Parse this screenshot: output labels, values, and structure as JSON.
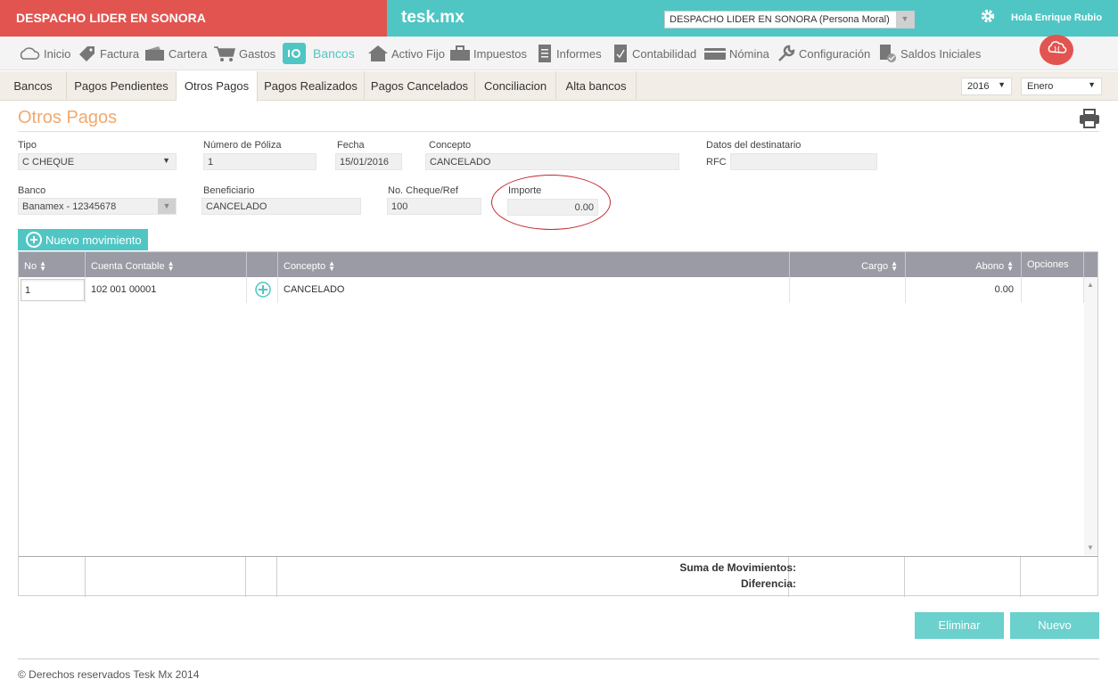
{
  "header": {
    "company": "DESPACHO LIDER EN SONORA",
    "brand": "tesk.mx",
    "company_selector": "DESPACHO LIDER EN SONORA (Persona Moral)",
    "greeting": "Hola Enrique Rubio"
  },
  "nav": {
    "items": [
      {
        "label": "Inicio",
        "icon": "cloud-icon"
      },
      {
        "label": "Factura",
        "icon": "tag-icon"
      },
      {
        "label": "Cartera",
        "icon": "wallet-icon"
      },
      {
        "label": "Gastos",
        "icon": "cart-icon"
      },
      {
        "label": "Bancos",
        "icon": "safe-icon"
      },
      {
        "label": "Activo Fijo",
        "icon": "house-icon"
      },
      {
        "label": "Impuestos",
        "icon": "briefcase-icon"
      },
      {
        "label": "Informes",
        "icon": "document-icon"
      },
      {
        "label": "Contabilidad",
        "icon": "ledger-icon"
      },
      {
        "label": "Nómina",
        "icon": "card-icon"
      },
      {
        "label": "Configuración",
        "icon": "wrench-icon"
      },
      {
        "label": "Saldos Iniciales",
        "icon": "file-check-icon"
      }
    ],
    "active": "Bancos"
  },
  "tabs": {
    "items": [
      "Bancos",
      "Pagos Pendientes",
      "Otros Pagos",
      "Pagos Realizados",
      "Pagos Cancelados",
      "Conciliacion",
      "Alta bancos"
    ],
    "active": "Otros Pagos",
    "year": "2016",
    "month": "Enero"
  },
  "page": {
    "title": "Otros Pagos"
  },
  "form": {
    "tipo_label": "Tipo",
    "tipo_value": "C CHEQUE",
    "poliza_label": "Número de Póliza",
    "poliza_value": "1",
    "fecha_label": "Fecha",
    "fecha_value": "15/01/2016",
    "concepto_label": "Concepto",
    "concepto_value": "CANCELADO",
    "destinatario_label": "Datos del destinatario",
    "rfc_label": "RFC",
    "rfc_value": "",
    "banco_label": "Banco",
    "banco_value": "Banamex - 12345678",
    "beneficiario_label": "Beneficiario",
    "beneficiario_value": "CANCELADO",
    "cheque_label": "No. Cheque/Ref",
    "cheque_value": "100",
    "importe_label": "Importe",
    "importe_value": "0.00"
  },
  "actions": {
    "new_movement": "Nuevo movimiento",
    "delete": "Eliminar",
    "new": "Nuevo"
  },
  "table": {
    "columns": [
      "No",
      "Cuenta Contable",
      "",
      "Concepto",
      "Cargo",
      "Abono",
      "Opciones"
    ],
    "rows": [
      {
        "no": "1",
        "cuenta": "102 001 00001",
        "concepto": "CANCELADO",
        "cargo": "",
        "abono": "0.00"
      }
    ],
    "sum_label": "Suma de Movimientos:",
    "diff_label": "Diferencia:"
  },
  "footer": "© Derechos reservados Tesk Mx 2014",
  "colors": {
    "red": "#e25450",
    "teal": "#4fc6c4",
    "title_orange": "#f2a96e",
    "table_header": "#9b9ba5"
  }
}
